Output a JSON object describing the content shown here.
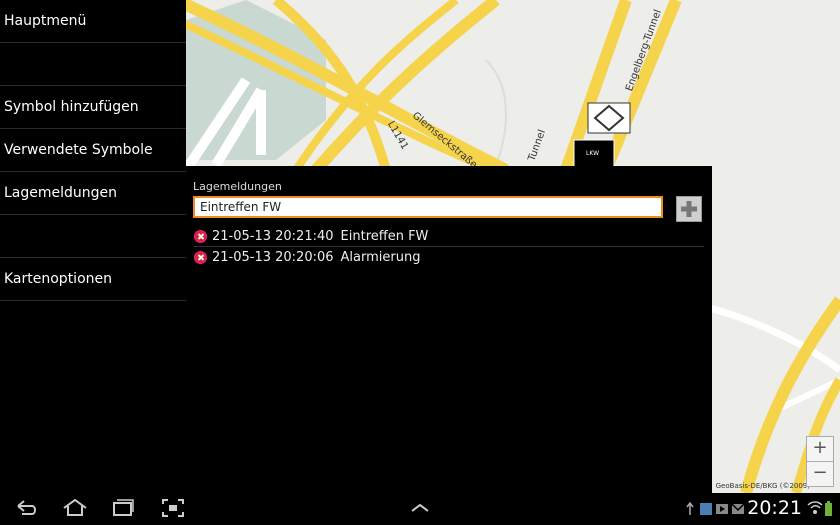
{
  "sidebar": {
    "items": [
      {
        "label": "Hauptmenü"
      },
      {
        "label": ""
      },
      {
        "label": "Symbol hinzufügen"
      },
      {
        "label": "Verwendete Symbole"
      },
      {
        "label": "Lagemeldungen"
      },
      {
        "label": ""
      },
      {
        "label": "Kartenoptionen"
      }
    ]
  },
  "map": {
    "labels": {
      "road_l1141": "L1141",
      "road_glemseck": "Glemseckstraße",
      "tunnel_engelberg": "Engelberg-Tunnel",
      "tunnel_short": "Tunnel",
      "vehicle": "LKW"
    },
    "attribution": "GeoBasis-DE/BKG (©2009)",
    "zoom_in": "+",
    "zoom_out": "−",
    "colors": {
      "road": "#f5d34a",
      "water": "#b7d0cf",
      "land": "#ededea"
    }
  },
  "panel": {
    "title": "Lagemeldungen",
    "input_value": "Eintreffen FW",
    "entries": [
      {
        "time": "21-05-13 20:21:40",
        "text": "Eintreffen FW"
      },
      {
        "time": "21-05-13 20:20:06",
        "text": "Alarmierung"
      }
    ],
    "accent": "#f08c1e"
  },
  "statusbar": {
    "clock": "20:21"
  }
}
